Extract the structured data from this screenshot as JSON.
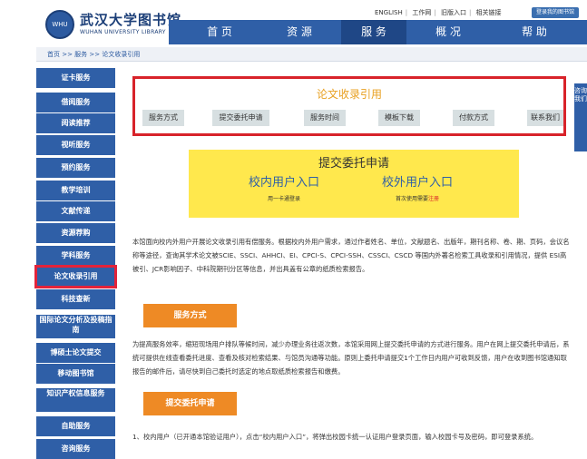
{
  "header": {
    "logo_cn": "武汉大学图书馆",
    "logo_en": "WUHAN UNIVERSITY LIBRARY",
    "logo_seal": "WHU",
    "top_links": [
      "ENGLISH",
      "工作网",
      "旧版入口",
      "相关链接"
    ],
    "my_library": "登录我的图书馆"
  },
  "nav": {
    "items": [
      "首 页",
      "资 源",
      "服 务",
      "概 况",
      "帮 助"
    ],
    "active_index": 2
  },
  "breadcrumb": "首页 >> 服务 >> 论文收录引用",
  "sidebar": {
    "items": [
      "证卡服务",
      "借阅服务",
      "阅读推荐",
      "视听服务",
      "预约服务",
      "教学培训",
      "文献传递",
      "资源荐购",
      "学科服务",
      "论文收录引用",
      "科技查新",
      "国际论文分析及投稿指南",
      "博硕士论文提交",
      "移动图书馆",
      "知识产权信息服务",
      "自助服务",
      "咨询服务"
    ],
    "selected_index": 9
  },
  "top_box": {
    "title": "论文收录引用",
    "tabs": [
      "服务方式",
      "提交委托申请",
      "服务时间",
      "模板下载",
      "付款方式",
      "联系我们"
    ]
  },
  "entry": {
    "title": "提交委托申请",
    "internal": "校内用户入口",
    "internal_sub": "用一卡通登录",
    "external": "校外用户入口",
    "external_sub": "首次使用需要",
    "external_reg": "注册"
  },
  "intro": "本馆面向校内外用户开展论文收录引用有偿服务。根据校内外用户需求，通过作者姓名、单位，文献题名、出版年，期刊名称、卷、期、页码，会议名称等途径，查询其学术论文被SCIE、SSCI、AHHCI、EI、CPCI-S、CPCI-SSH、CSSCI、CSCD 等国内外著名检索工具收录和引用情况，提供 ESI高被引、JCR影响因子、中科院期刊分区等信息，并出具盖有公章的纸质检索报告。",
  "section1": {
    "button": "服务方式",
    "text": "为提高服务效率，缩短现场用户排队等候时间，减少办理业务往返次数，本馆采用网上提交委托申请的方式进行服务。用户在网上提交委托申请后，系统可提供在线查看委托进度、查看及核对检索结果、与馆员沟通等功能。原则上委托申请提交1个工作日内用户可收到反馈，用户在收到图书馆通知取报告的邮件后，请尽快到自己委托时选定的地点取纸质检索报告和缴费。"
  },
  "section2": {
    "button": "提交委托申请",
    "text": "1、校内用户（已开通本馆验证用户），点击“校内用户入口”，将弹出校园卡统一认证用户登录页面，输入校园卡号及密码，即可登录系统。"
  },
  "right_tab": "咨询我们"
}
